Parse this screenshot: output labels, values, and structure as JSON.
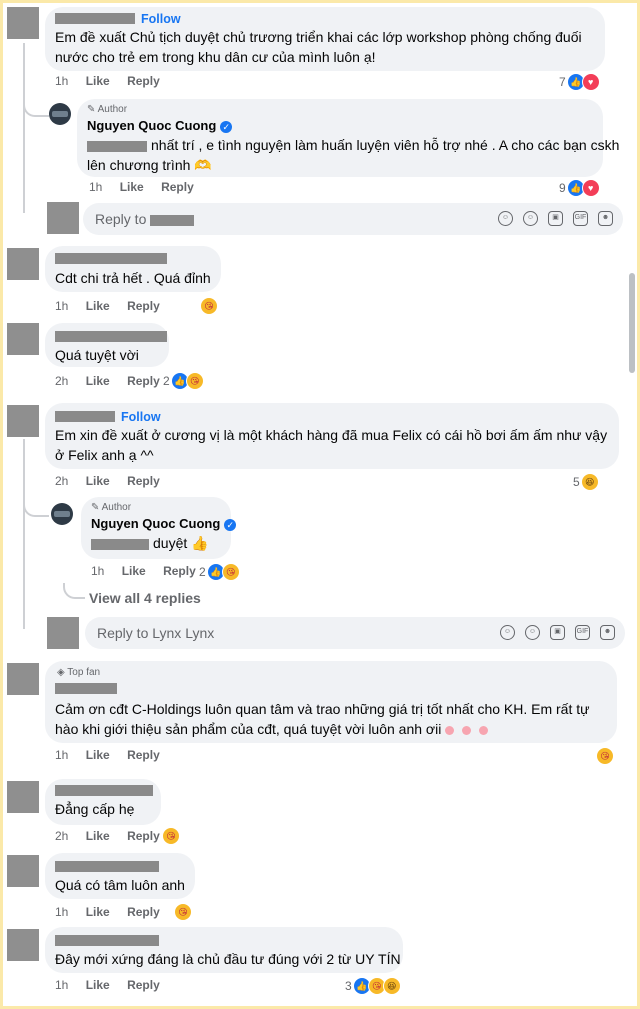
{
  "comments": {
    "c1": {
      "follow": "Follow",
      "text_line1": "Em đề xuất Chủ tịch duyệt chủ trương triển khai các lớp workshop phòng chống đuối",
      "text_line2": "nước cho trẻ em trong khu dân cư của mình luôn ạ!",
      "time": "1h",
      "like": "Like",
      "reply": "Reply",
      "reaction_count": "7",
      "reply_author": {
        "label": "Author",
        "name": "Nguyen Quoc Cuong",
        "text_line1": "nhất trí , e tình nguyện làm huấn luyện viên hỗ trợ nhé . A cho các bạn cskh",
        "text_line2": "lên chương trình 🫶",
        "time": "1h",
        "like": "Like",
        "reply": "Reply",
        "reaction_count": "9"
      },
      "reply_placeholder": "Reply to"
    },
    "c2": {
      "text": "Cdt chi trả hết . Quá đỉnh",
      "time": "1h",
      "like": "Like",
      "reply": "Reply"
    },
    "c3": {
      "text": "Quá tuyệt vời",
      "time": "2h",
      "like": "Like",
      "reply": "Reply",
      "reaction_count": "2"
    },
    "c4": {
      "follow": "Follow",
      "text_line1": "Em xin đề xuất ở cương vị là một khách hàng đã mua Felix có cái hồ bơi ấm ấm như vậy",
      "text_line2": "ở Felix anh ạ ^^",
      "time": "2h",
      "like": "Like",
      "reply": "Reply",
      "reaction_count": "5",
      "reply_author": {
        "label": "Author",
        "name": "Nguyen Quoc Cuong",
        "text": "duyệt 👍",
        "time": "1h",
        "like": "Like",
        "reply": "Reply",
        "reaction_count": "2"
      },
      "view_all": "View all 4 replies",
      "reply_placeholder": "Reply to Lynx Lynx"
    },
    "c5": {
      "label": "Top fan",
      "text_line1": "Cảm ơn cđt C-Holdings luôn quan tâm và trao những giá trị tốt nhất cho KH. Em rất tự",
      "text_line2": "hào khi giới thiệu sản phẩm của cđt, quá tuyệt vời luôn anh ơii",
      "time": "1h",
      "like": "Like",
      "reply": "Reply"
    },
    "c6": {
      "text": "Đẳng cấp hẹ",
      "time": "2h",
      "like": "Like",
      "reply": "Reply"
    },
    "c7": {
      "text": "Quá có tâm luôn anh",
      "time": "1h",
      "like": "Like",
      "reply": "Reply"
    },
    "c8": {
      "text": "Đây mới xứng đáng là chủ đầu tư đúng với 2 từ UY TÍN",
      "time": "1h",
      "like": "Like",
      "reply": "Reply",
      "reaction_count": "3"
    }
  },
  "icons": [
    "emoji-icon",
    "sticker-icon",
    "camera-icon",
    "gif-icon",
    "sticker-icon"
  ],
  "colors": {
    "border": "#fbe9a9",
    "bubble": "#f0f2f5",
    "link": "#1876f2",
    "meta": "#65676b"
  }
}
